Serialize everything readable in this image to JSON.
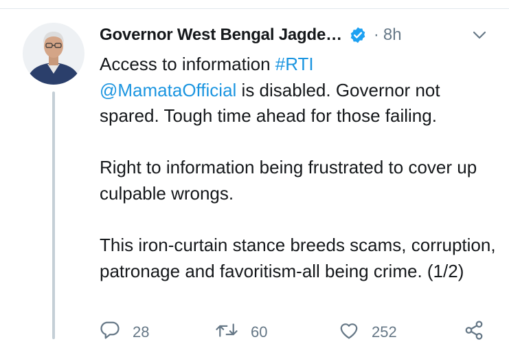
{
  "tweet": {
    "author_name": "Governor West Bengal Jagde…",
    "separator": "·",
    "time": "8h",
    "verified": true,
    "body": {
      "line1_text": "Access to information ",
      "hashtag": "#RTI",
      "mention": "@MamataOfficial",
      "line2_rest": " is disabled. Governor not spared. Tough time ahead for those failing.",
      "paragraph2": "Right to information being frustrated to cover up culpable wrongs.",
      "paragraph3": "This iron-curtain stance breeds scams, corruption, patronage and favoritism-all being crime. (1/2)"
    },
    "actions": {
      "reply_count": "28",
      "retweet_count": "60",
      "like_count": "252"
    }
  },
  "colors": {
    "link": "#1b95e0",
    "verified": "#1da1f2",
    "muted": "#657786",
    "text": "#14171a"
  },
  "icons": [
    "verified-badge-icon",
    "chevron-down-icon",
    "reply-icon",
    "retweet-icon",
    "like-icon",
    "share-icon"
  ]
}
